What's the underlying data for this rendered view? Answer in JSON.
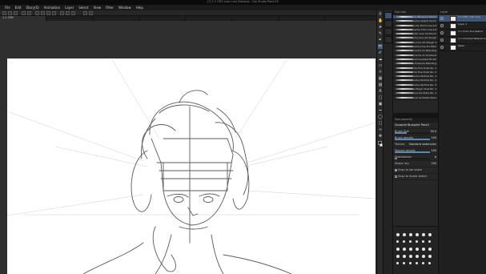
{
  "app": {
    "title": "[*] 1-1 CMY color Line Drawing - Clip Studio Paint EX",
    "menu": [
      "File",
      "Edit",
      "Story(S)",
      "Animation",
      "Layer",
      "Select",
      "View",
      "Filter",
      "Window",
      "Help"
    ],
    "tabs": [
      "1-1 CMY",
      "",
      "",
      "",
      "",
      "",
      ""
    ]
  },
  "colors": {
    "accent": "#4a5f7a",
    "selection": "#3e5676",
    "panel_bg": "#262626",
    "canvas_bg": "#2f2f2f"
  },
  "tools": [
    "zoom-icon",
    "hand-icon",
    "arrow-icon",
    "eyedropper-icon",
    "pen-icon",
    "pencil-icon",
    "brush-icon",
    "airbrush-icon",
    "eraser-icon",
    "blend-icon",
    "fill-icon",
    "gradient-icon",
    "text-icon",
    "figure-icon",
    "frame-icon",
    "ruler-icon",
    "balloon-icon",
    "selection-icon",
    "lasso-icon",
    "move-icon"
  ],
  "brushes": {
    "header": "Sub tool",
    "items": [
      "Gouache Blueprint Pencil",
      "Gouache Sketch Pencil",
      "Gouache Thick Line Art",
      "Gouache Thin Line Art",
      "Gouache Dramatic Line Art Pencil",
      "Gouache Line Art Rough",
      "Gouache Line Art Rough 2",
      "Gouache Line Art Plain",
      "Gouache 2x Blending",
      "Gouache 3x Gradient",
      "Gouache Curved Gradient Brush",
      "Gouache Pressure Blending",
      "Gouache Fine Dusk No. 1",
      "Gouache Fine Dusk No. 2",
      "Gouache Particle No. 1",
      "Gouache Particle No. 2",
      "Gouache Particle No. 3",
      "Gouache Magic Dust No. 1",
      "Gouache Stars No. 1",
      "Gouache Pastel Stars"
    ]
  },
  "tool_property": {
    "header": "Tool property",
    "brush_name": "Gouache Blueprint Pencil",
    "rows": [
      {
        "label": "Brush Size",
        "value": "30.0"
      },
      {
        "label": "Brush density",
        "value": "100"
      },
      {
        "label": "Texture",
        "value": "Standard watercolor"
      },
      {
        "label": "Texture density",
        "value": "100"
      },
      {
        "label": "Stabilization",
        "value": "6"
      },
      {
        "label": "Shape rely",
        "value": "100"
      }
    ],
    "checks": [
      "Snap to lab snake",
      "Snap to Snake sketch"
    ]
  },
  "layers": {
    "header": "Layer",
    "items": [
      {
        "name": "1-1 CMY color Line",
        "selected": true
      },
      {
        "name": "Layer 1",
        "selected": false
      },
      {
        "name": "1-1 Color line Sketch",
        "selected": false
      },
      {
        "name": "1-1 Checked Reference",
        "selected": false
      },
      {
        "name": "Paper",
        "selected": false
      }
    ]
  }
}
